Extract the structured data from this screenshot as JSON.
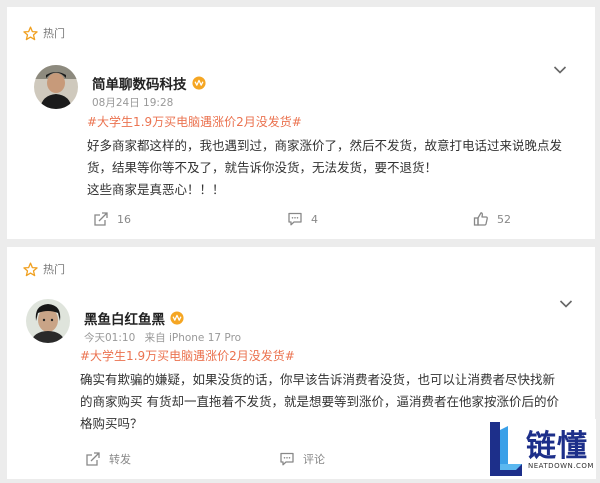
{
  "posts": [
    {
      "hot_label": "热门",
      "username": "简单聊数码科技",
      "date": "08月24日 19:28",
      "source": "",
      "topic": "#大学生1.9万买电脑遇涨价2月没发货#",
      "lines": [
        "好多商家都这样的，我也遇到过，商家涨价了，然后不发货，故意打电话过来说晚点发",
        "货，结果等你等不及了，就告诉你没货，无法发货，要不退货！",
        "这些商家是真恶心！！！"
      ],
      "repost": "16",
      "comment": "4",
      "like": "52"
    },
    {
      "hot_label": "热门",
      "username": "黑鱼白红鱼黑",
      "date": "今天01:10",
      "source": "来自 iPhone 17 Pro",
      "topic": "#大学生1.9万买电脑遇涨价2月没发货#",
      "lines": [
        "确实有欺骗的嫌疑，如果没货的话，你早该告诉消费者没货，也可以让消费者尽快找新",
        "的商家购买 有货却一直拖着不发货，就是想要等到涨价，逼消费者在他家按涨价后的价",
        "格购买吗？"
      ],
      "repost": "转发",
      "comment": "评论",
      "like": ""
    }
  ],
  "watermark": {
    "main": "链懂",
    "sub": "NEATDOWN.COM"
  },
  "colors": {
    "topic": "#eb7350",
    "badge": "#f5a623",
    "watermark": "#1d2f8a"
  }
}
